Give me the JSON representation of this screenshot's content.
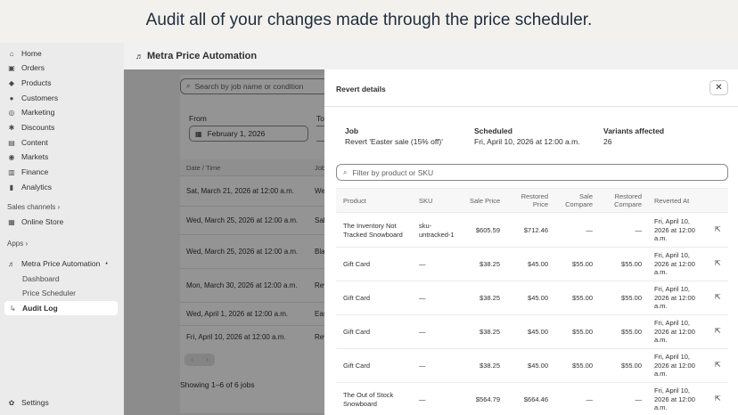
{
  "headline": "Audit all of your changes made through the price scheduler.",
  "sidebar": {
    "items": [
      {
        "label": "Home",
        "icon": "home-icon",
        "glyph": "⌂"
      },
      {
        "label": "Orders",
        "icon": "orders-icon",
        "glyph": "▣"
      },
      {
        "label": "Products",
        "icon": "tag-icon",
        "glyph": "◆"
      },
      {
        "label": "Customers",
        "icon": "person-icon",
        "glyph": "●"
      },
      {
        "label": "Marketing",
        "icon": "target-icon",
        "glyph": "◎"
      },
      {
        "label": "Discounts",
        "icon": "discount-icon",
        "glyph": "✱"
      },
      {
        "label": "Content",
        "icon": "content-icon",
        "glyph": "▤"
      },
      {
        "label": "Markets",
        "icon": "globe-icon",
        "glyph": "◉"
      },
      {
        "label": "Finance",
        "icon": "bank-icon",
        "glyph": "▥"
      },
      {
        "label": "Analytics",
        "icon": "chart-icon",
        "glyph": "▮"
      }
    ],
    "sales_channels_label": "Sales channels",
    "online_store": "Online Store",
    "apps_label": "Apps",
    "app_name": "Metra Price Automation",
    "app_sub": [
      "Dashboard",
      "Price Scheduler",
      "Audit Log"
    ],
    "settings": "Settings"
  },
  "main": {
    "title": "Metra Price Automation",
    "search_placeholder": "Search by job name or condition",
    "from_label": "From",
    "to_label": "To",
    "from_date": "February 1, 2026",
    "col_date": "Date / Time",
    "col_job": "Job",
    "rows": [
      {
        "date": "Sat, March 21, 2026 at 12:00 a.m.",
        "job": "We"
      },
      {
        "date": "Wed, March 25, 2026 at 12:00 a.m.",
        "job": "Sal"
      },
      {
        "date": "Wed, March 25, 2026 at 12:00 a.m.",
        "job": "Bla"
      },
      {
        "date": "Mon, March 30, 2026 at 12:00 a.m.",
        "job": "Rev"
      },
      {
        "date": "Wed, April 1, 2026 at 12:00 a.m.",
        "job": "Eas"
      },
      {
        "date": "Fri, April 10, 2026 at 12:00 a.m.",
        "job": "Rev"
      }
    ],
    "showing": "Showing 1–6 of 6 jobs"
  },
  "panel": {
    "title": "Revert details",
    "job_label": "Job",
    "job_value": "Revert 'Easter sale (15% off)'",
    "scheduled_label": "Scheduled",
    "scheduled_value": "Fri, April 10, 2026 at 12:00 a.m.",
    "variants_label": "Variants affected",
    "variants_value": "26",
    "filter_placeholder": "Filter by product or SKU",
    "columns": {
      "product": "Product",
      "sku": "SKU",
      "sale_price": "Sale Price",
      "restored_price_1": "Restored",
      "restored_price_2": "Price",
      "sale_compare_1": "Sale",
      "sale_compare_2": "Compare",
      "restored_compare_1": "Restored",
      "restored_compare_2": "Compare",
      "reverted_at": "Reverted At"
    },
    "rows": [
      {
        "product_1": "The Inventory Not",
        "product_2": "Tracked Snowboard",
        "sku_1": "sku-",
        "sku_2": "untracked-1",
        "sale": "$605.59",
        "restored": "$712.46",
        "sale_cmp": "—",
        "rest_cmp": "—",
        "rev_1": "Fri, April 10,",
        "rev_2": "2026 at 12:00",
        "rev_3": "a.m."
      },
      {
        "product_1": "Gift Card",
        "product_2": "",
        "sku_1": "—",
        "sku_2": "",
        "sale": "$38.25",
        "restored": "$45.00",
        "sale_cmp": "$55.00",
        "rest_cmp": "$55.00",
        "rev_1": "Fri, April 10,",
        "rev_2": "2026 at 12:00",
        "rev_3": "a.m."
      },
      {
        "product_1": "Gift Card",
        "product_2": "",
        "sku_1": "—",
        "sku_2": "",
        "sale": "$38.25",
        "restored": "$45.00",
        "sale_cmp": "$55.00",
        "rest_cmp": "$55.00",
        "rev_1": "Fri, April 10,",
        "rev_2": "2026 at 12:00",
        "rev_3": "a.m."
      },
      {
        "product_1": "Gift Card",
        "product_2": "",
        "sku_1": "—",
        "sku_2": "",
        "sale": "$38.25",
        "restored": "$45.00",
        "sale_cmp": "$55.00",
        "rest_cmp": "$55.00",
        "rev_1": "Fri, April 10,",
        "rev_2": "2026 at 12:00",
        "rev_3": "a.m."
      },
      {
        "product_1": "Gift Card",
        "product_2": "",
        "sku_1": "—",
        "sku_2": "",
        "sale": "$38.25",
        "restored": "$45.00",
        "sale_cmp": "$55.00",
        "rest_cmp": "$55.00",
        "rev_1": "Fri, April 10,",
        "rev_2": "2026 at 12:00",
        "rev_3": "a.m."
      },
      {
        "product_1": "The Out of Stock",
        "product_2": "Snowboard",
        "sku_1": "—",
        "sku_2": "",
        "sale": "$564.79",
        "restored": "$664.46",
        "sale_cmp": "—",
        "rest_cmp": "—",
        "rev_1": "Fri, April 10,",
        "rev_2": "2026 at 12:00",
        "rev_3": "a.m."
      }
    ]
  }
}
